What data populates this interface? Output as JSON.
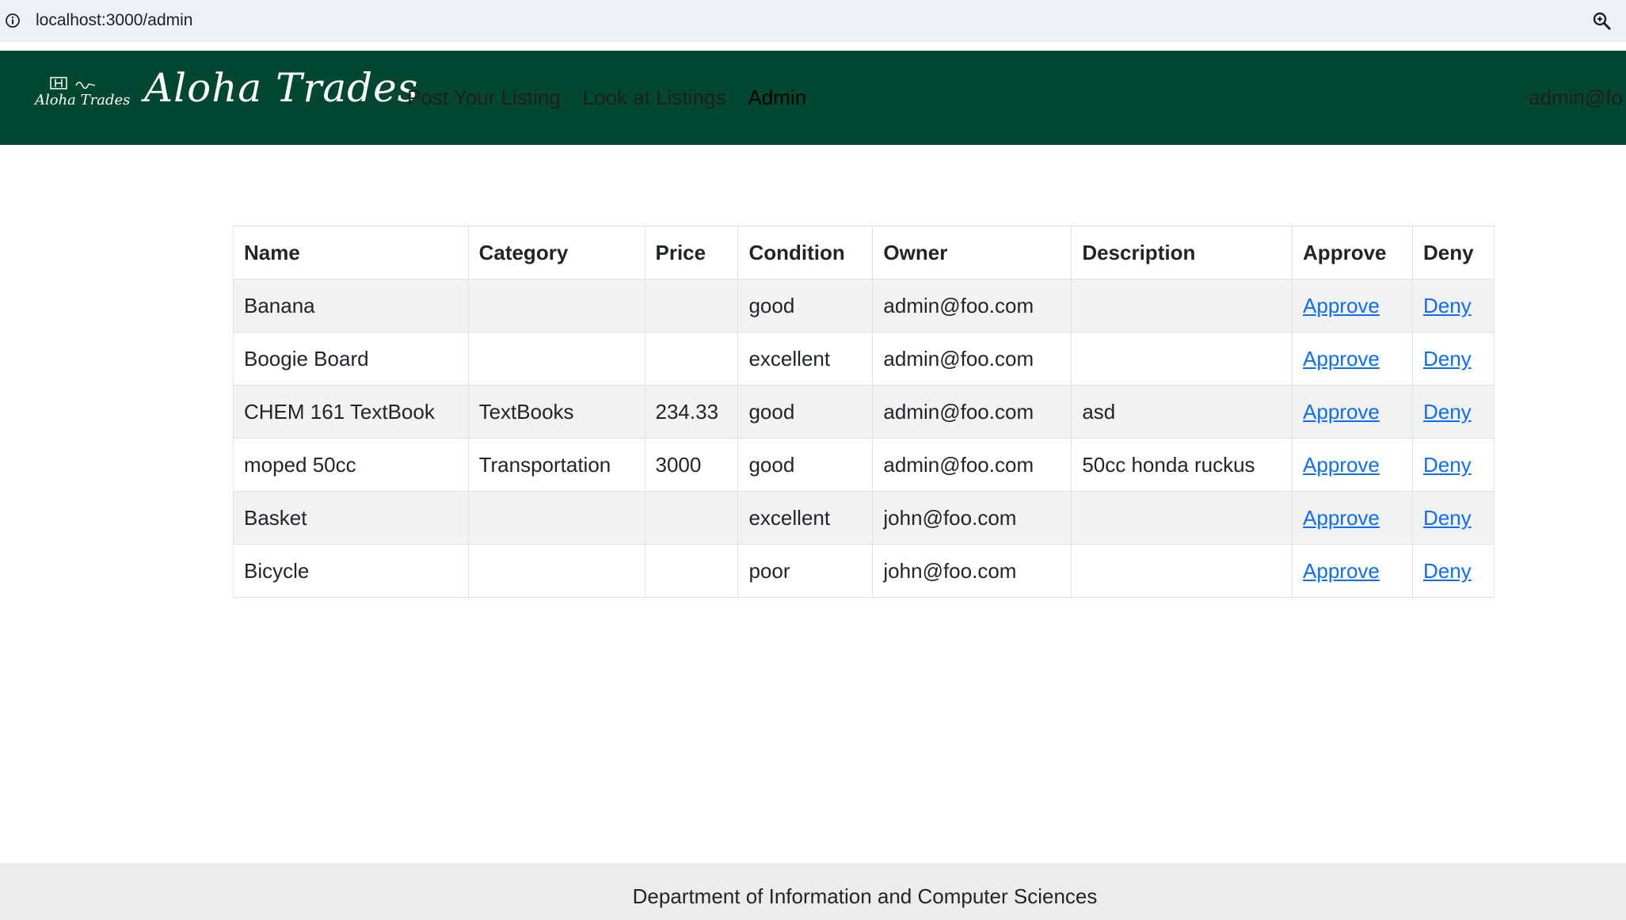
{
  "browser": {
    "url": "localhost:3000/admin"
  },
  "navbar": {
    "logo_text": "Aloha Trades",
    "brand": "Aloha Trades",
    "links": [
      {
        "label": "Post Your Listing"
      },
      {
        "label": "Look at Listings"
      },
      {
        "label": "Admin"
      }
    ],
    "user": "admin@fo"
  },
  "table": {
    "headers": [
      "Name",
      "Category",
      "Price",
      "Condition",
      "Owner",
      "Description",
      "Approve",
      "Deny"
    ],
    "rows": [
      {
        "name": "Banana",
        "category": "",
        "price": "",
        "condition": "good",
        "owner": "admin@foo.com",
        "description": "",
        "approve": "Approve",
        "deny": "Deny"
      },
      {
        "name": "Boogie Board",
        "category": "",
        "price": "",
        "condition": "excellent",
        "owner": "admin@foo.com",
        "description": "",
        "approve": "Approve",
        "deny": "Deny"
      },
      {
        "name": "CHEM 161 TextBook",
        "category": "TextBooks",
        "price": "234.33",
        "condition": "good",
        "owner": "admin@foo.com",
        "description": "asd",
        "approve": "Approve",
        "deny": "Deny"
      },
      {
        "name": "moped 50cc",
        "category": "Transportation",
        "price": "3000",
        "condition": "good",
        "owner": "admin@foo.com",
        "description": "50cc honda ruckus",
        "approve": "Approve",
        "deny": "Deny"
      },
      {
        "name": "Basket",
        "category": "",
        "price": "",
        "condition": "excellent",
        "owner": "john@foo.com",
        "description": "",
        "approve": "Approve",
        "deny": "Deny"
      },
      {
        "name": "Bicycle",
        "category": "",
        "price": "",
        "condition": "poor",
        "owner": "john@foo.com",
        "description": "",
        "approve": "Approve",
        "deny": "Deny"
      }
    ]
  },
  "footer": {
    "text": "Department of Information and Computer Sciences"
  },
  "colors": {
    "navbar": "#024731",
    "link": "#0d6efd",
    "row_stripe": "#f2f2f2",
    "footer": "#ececec"
  }
}
